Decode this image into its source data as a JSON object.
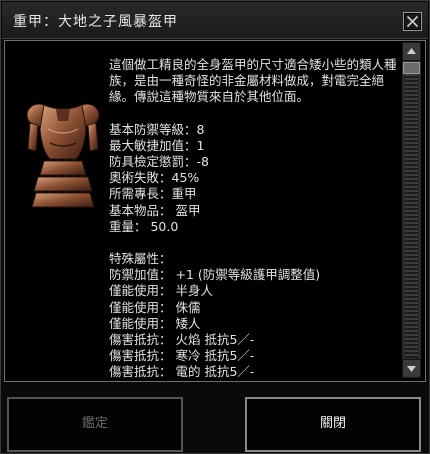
{
  "window": {
    "title": "重甲：大地之子風暴盔甲",
    "close_icon": "close-icon"
  },
  "item": {
    "portrait_icon": "armor-portrait",
    "description": "這個做工精良的全身盔甲的尺寸適合矮小些的類人種族，是由一種奇怪的非金屬材料做成，對電完全絕緣。傳說這種物質來自於其他位面。",
    "stats": [
      "基本防禦等級：8",
      "最大敏捷加值：1",
      "防具檢定懲罰：-8",
      "奧術失敗：45%",
      "所需專長：重甲",
      "基本物品： 盔甲",
      "重量： 50.0"
    ],
    "properties": [
      "特殊屬性：",
      "防禦加值： +1 (防禦等級護甲調整值)",
      "僅能使用： 半身人",
      "僅能使用： 侏儒",
      "僅能使用： 矮人",
      "傷害抵抗： 火焰 抵抗5／-",
      "傷害抵抗： 寒冷 抵抗5／-",
      "傷害抵抗： 電的 抵抗5／-"
    ]
  },
  "buttons": {
    "identify": "鑑定",
    "close": "關閉"
  }
}
